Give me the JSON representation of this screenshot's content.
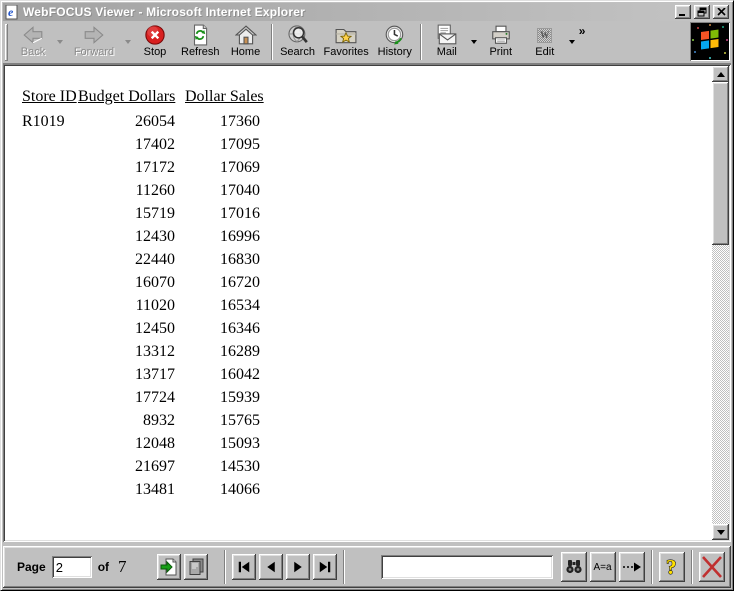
{
  "window": {
    "title": "WebFOCUS Viewer - Microsoft Internet Explorer"
  },
  "toolbar": {
    "buttons": [
      {
        "label": "Back",
        "disabled": true,
        "dropdown": true
      },
      {
        "label": "Forward",
        "disabled": true,
        "dropdown": true
      },
      {
        "label": "Stop"
      },
      {
        "label": "Refresh"
      },
      {
        "label": "Home"
      },
      {
        "label": "Search"
      },
      {
        "label": "Favorites"
      },
      {
        "label": "History"
      },
      {
        "label": "Mail",
        "dropdown": true
      },
      {
        "label": "Print"
      },
      {
        "label": "Edit",
        "dropdown": true
      }
    ],
    "overflow_chevron": "»"
  },
  "table": {
    "columns": [
      "Store ID",
      "Budget Dollars",
      "Dollar Sales"
    ],
    "rows": [
      [
        "R1019",
        "26054",
        "17360"
      ],
      [
        "",
        "17402",
        "17095"
      ],
      [
        "",
        "17172",
        "17069"
      ],
      [
        "",
        "11260",
        "17040"
      ],
      [
        "",
        "15719",
        "17016"
      ],
      [
        "",
        "12430",
        "16996"
      ],
      [
        "",
        "22440",
        "16830"
      ],
      [
        "",
        "16070",
        "16720"
      ],
      [
        "",
        "11020",
        "16534"
      ],
      [
        "",
        "12450",
        "16346"
      ],
      [
        "",
        "13312",
        "16289"
      ],
      [
        "",
        "13717",
        "16042"
      ],
      [
        "",
        "17724",
        "15939"
      ],
      [
        "",
        "8932",
        "15765"
      ],
      [
        "",
        "12048",
        "15093"
      ],
      [
        "",
        "21697",
        "14530"
      ],
      [
        "",
        "13481",
        "14066"
      ]
    ]
  },
  "pager": {
    "page_label": "Page",
    "current_page": "2",
    "of_label": "of",
    "total_pages": "7"
  },
  "find": {
    "input_value": "",
    "case_button_label": "A=a"
  },
  "icons": {
    "edit_glyph": "W"
  },
  "colors": {
    "chrome": "#c0c0c0",
    "content_bg": "#ffffff",
    "titlebar_text": "#ffffff",
    "stop_red": "#dd2222",
    "close_red": "#c03030",
    "help_yellow": "#ffe000",
    "go_green": "#18a018"
  }
}
